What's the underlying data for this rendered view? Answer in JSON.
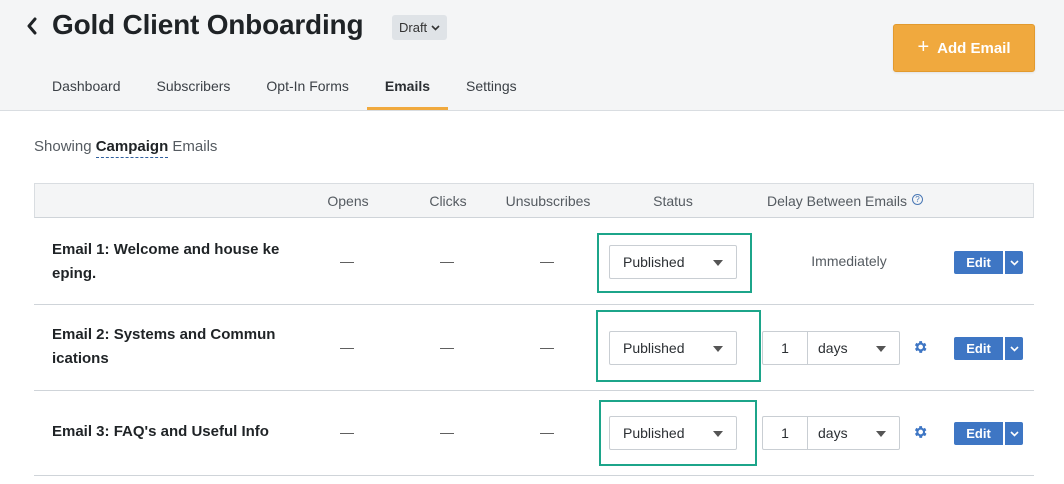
{
  "header": {
    "title": "Gold Client Onboarding",
    "status_badge": "Draft",
    "add_button": "Add Email",
    "accent": "#f0a93e"
  },
  "tabs": [
    {
      "label": "Dashboard"
    },
    {
      "label": "Subscribers"
    },
    {
      "label": "Opt-In Forms"
    },
    {
      "label": "Emails",
      "active": true
    },
    {
      "label": "Settings"
    }
  ],
  "showing": {
    "prefix": "Showing",
    "selected": "Campaign",
    "suffix": "Emails"
  },
  "table": {
    "columns": [
      "Opens",
      "Clicks",
      "Unsubscribes",
      "Status",
      "Delay Between Emails"
    ],
    "rows": [
      {
        "name_line1": "Email 1: Welcome and house ke",
        "name_line2": "eping.",
        "opens": "—",
        "clicks": "—",
        "unsubscribes": "—",
        "status": "Published",
        "delay": "Immediately",
        "edit": "Edit"
      },
      {
        "name_line1": "Email 2: Systems and Commun",
        "name_line2": "ications",
        "opens": "—",
        "clicks": "—",
        "unsubscribes": "—",
        "status": "Published",
        "delay_value": "1",
        "delay_unit": "days",
        "edit": "Edit"
      },
      {
        "name_line1": "Email 3: FAQ's and Useful Info",
        "opens": "—",
        "clicks": "—",
        "unsubscribes": "—",
        "status": "Published",
        "delay_value": "1",
        "delay_unit": "days",
        "edit": "Edit"
      }
    ]
  },
  "highlight_color": "#1ca58a",
  "icons": {
    "back": "chevron-left-icon",
    "badge": "chevron-down-icon",
    "add": "plus-icon",
    "help": "question-circle-icon",
    "settings": "gear-icon",
    "edit_menu": "chevron-down-icon"
  }
}
